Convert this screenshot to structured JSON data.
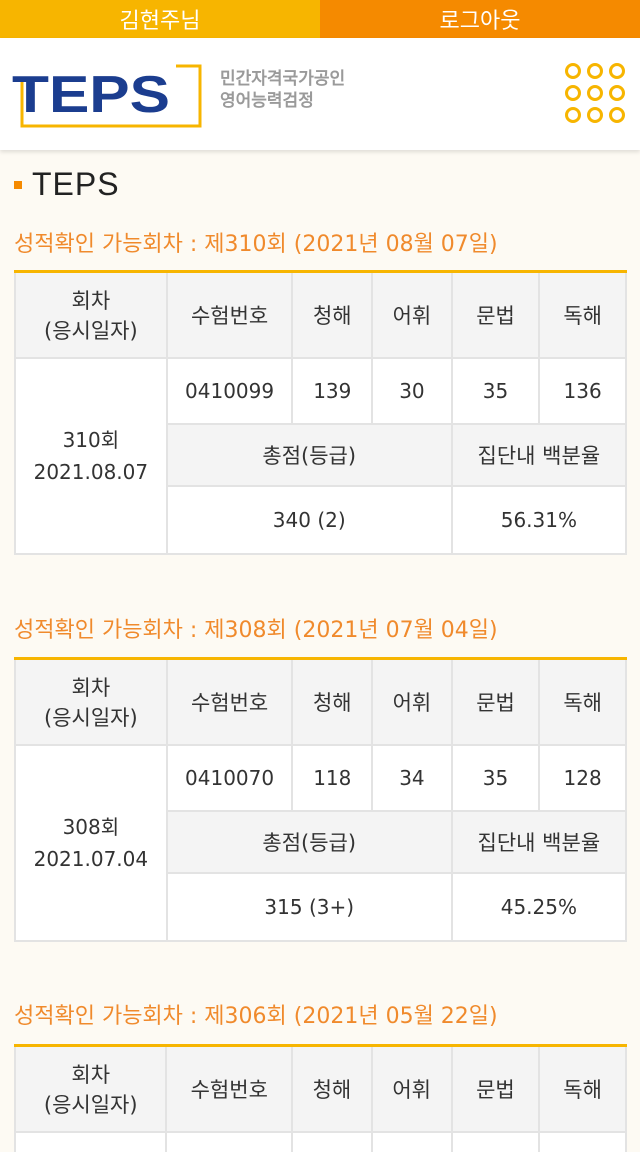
{
  "topbar": {
    "user_label": "김현주님",
    "logout_label": "로그아웃"
  },
  "header": {
    "logo_text": "TEPS",
    "logo_sub_line1": "민간자격국가공인",
    "logo_sub_line2": "영어능력검정"
  },
  "section_title": "TEPS",
  "headers": {
    "round": "회차",
    "round_sub": "(응시일자)",
    "exam_no": "수험번호",
    "listening": "청해",
    "vocab": "어휘",
    "grammar": "문법",
    "reading": "독해",
    "total": "총점(등급)",
    "percentile": "집단내 백분율"
  },
  "results": [
    {
      "heading": "성적확인 가능회차 : 제310회 (2021년 08월 07일)",
      "round": "310회",
      "date": "2021.08.07",
      "exam_no": "0410099",
      "listening": "139",
      "vocab": "30",
      "grammar": "35",
      "reading": "136",
      "total": "340 (2)",
      "percentile": "56.31%"
    },
    {
      "heading": "성적확인 가능회차 : 제308회 (2021년 07월 04일)",
      "round": "308회",
      "date": "2021.07.04",
      "exam_no": "0410070",
      "listening": "118",
      "vocab": "34",
      "grammar": "35",
      "reading": "128",
      "total": "315 (3+)",
      "percentile": "45.25%"
    },
    {
      "heading": "성적확인 가능회차 : 제306회 (2021년 05월 22일)"
    }
  ],
  "colors": {
    "yellow": "#f7b500",
    "orange": "#f58a00",
    "heading_orange": "#f08a2c",
    "logo_blue": "#1b3d8f"
  }
}
